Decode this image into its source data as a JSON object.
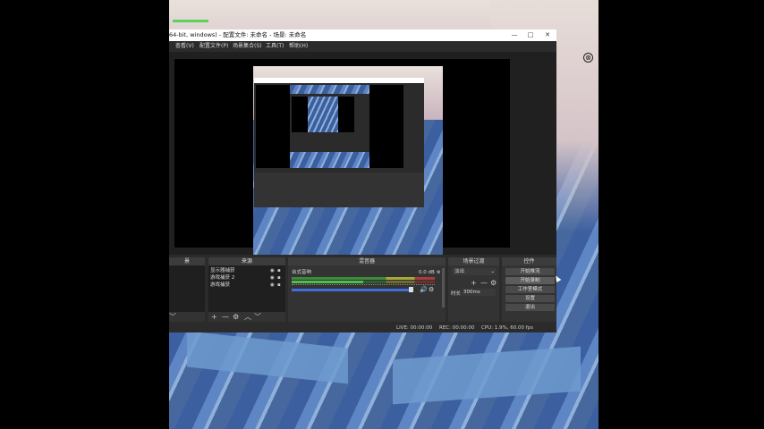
{
  "window": {
    "title": "64-bit, windows) - 配置文件: 未命名 - 场景: 未命名",
    "buttons": {
      "minimize": "—",
      "maximize": "□",
      "close": "✕"
    }
  },
  "menu": [
    {
      "label": "查看(V)"
    },
    {
      "label": "配置文件(P)"
    },
    {
      "label": "场景集合(S)"
    },
    {
      "label": "工具(T)"
    },
    {
      "label": "帮助(H)"
    }
  ],
  "docks": {
    "scenes": {
      "header": "景",
      "tools": [
        "﹀"
      ]
    },
    "sources": {
      "header": "来源",
      "items": [
        {
          "label": "显示器捕获"
        },
        {
          "label": "游戏捕获 2"
        },
        {
          "label": "游戏捕获"
        }
      ],
      "tools": [
        "+",
        "—",
        "⚙",
        "︿",
        "﹀"
      ]
    },
    "mixer": {
      "header": "混音器",
      "track_label": "台式音响",
      "track_db": "0.0 dB",
      "scale_ticks": [
        "-60",
        "-55",
        "-50",
        "-45",
        "-40",
        "-35",
        "-30",
        "-25",
        "-20",
        "-15",
        "-10",
        "-5",
        "0"
      ],
      "volume_level": 0.83
    },
    "transitions": {
      "header": "场景过渡",
      "selected": "淡出",
      "duration_label": "时长",
      "duration_value": "300ms",
      "tools": [
        "+",
        "—",
        "⚙"
      ]
    },
    "controls": {
      "header": "控件",
      "buttons": [
        {
          "label": "开始推流"
        },
        {
          "label": "开始录制"
        },
        {
          "label": "工作室模式"
        },
        {
          "label": "设置"
        },
        {
          "label": "退出"
        }
      ]
    }
  },
  "statusbar": {
    "live": "LIVE: 00:00:00",
    "rec": "REC: 00:00:00",
    "cpu": "CPU: 1.9%, 60.00 fps"
  },
  "overlay": {
    "close_icon": "⊗"
  }
}
